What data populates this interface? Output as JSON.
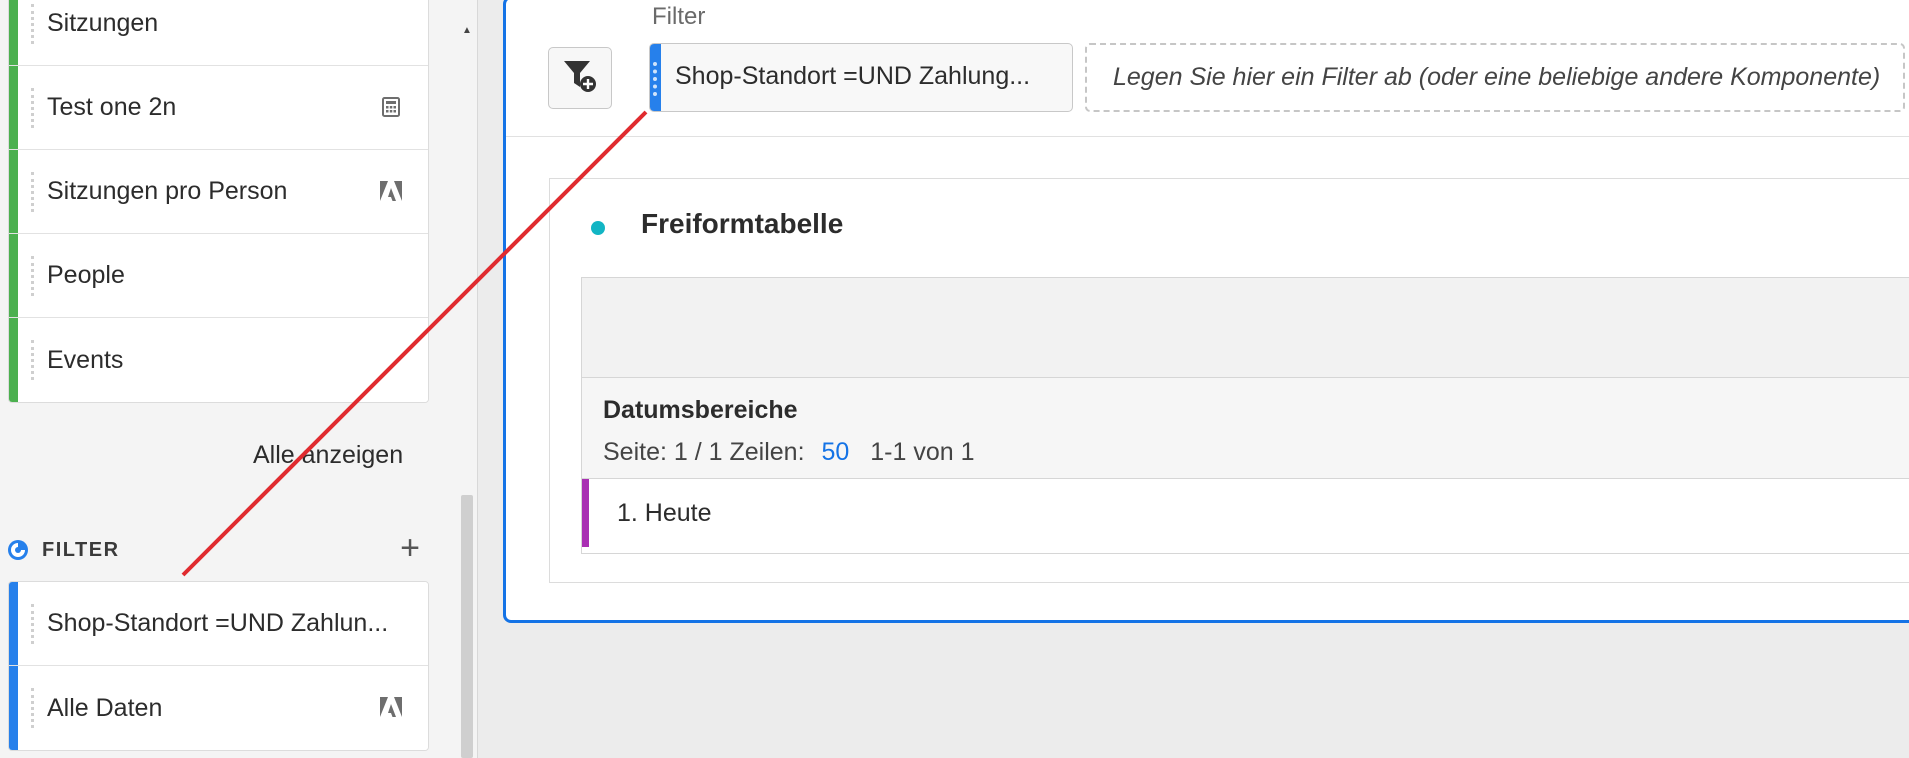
{
  "sidebar": {
    "metrics": [
      {
        "label": "Sitzungen",
        "color": "#4bb04f",
        "icon": ""
      },
      {
        "label": "Test one 2n",
        "color": "#4bb04f",
        "icon": "calculator-icon"
      },
      {
        "label": "Sitzungen pro Person",
        "color": "#4bb04f",
        "icon": "adobe-logo-icon"
      },
      {
        "label": "People",
        "color": "#4bb04f",
        "icon": ""
      },
      {
        "label": "Events",
        "color": "#4bb04f",
        "icon": ""
      }
    ],
    "show_all_label": "Alle anzeigen",
    "filter_section_title": "FILTER",
    "filters": [
      {
        "label": "Shop-Standort =UND Zahlun...",
        "color": "#2680eb",
        "icon": ""
      },
      {
        "label": "Alle Daten",
        "color": "#2680eb",
        "icon": "adobe-logo-icon"
      }
    ]
  },
  "panel": {
    "filter_caption": "Filter",
    "applied_filter_chip": "Shop-Standort =UND Zahlung...",
    "drop_zone_placeholder": "Legen Sie hier ein Filter ab (oder eine beliebige andere Komponente)",
    "accent_color": "#1473e6"
  },
  "visualization": {
    "title": "Freiformtabelle",
    "dot_color": "#12b5c4",
    "dimension": "Datumsbereiche",
    "pager": {
      "page": "Seite: 1 / 1",
      "rows_label": "Zeilen:",
      "rows_value": "50",
      "range": "1-1 von 1"
    },
    "rows": [
      {
        "label": "1.  Heute",
        "color": "#a92fb3"
      }
    ]
  }
}
